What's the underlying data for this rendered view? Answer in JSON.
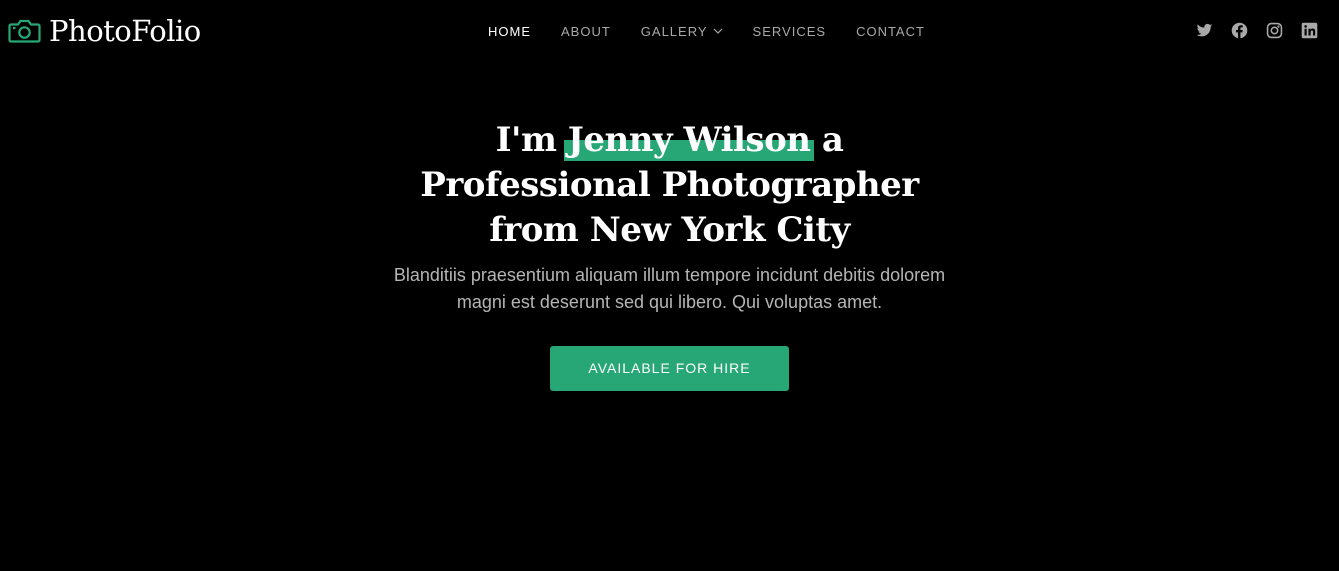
{
  "brand": {
    "name": "PhotoFolio",
    "icon": "camera-icon",
    "accent_color": "#27a776"
  },
  "nav": {
    "items": [
      {
        "label": "HOME",
        "active": true
      },
      {
        "label": "ABOUT",
        "active": false
      },
      {
        "label": "GALLERY",
        "active": false,
        "dropdown_icon": "chevron-down-icon"
      },
      {
        "label": "SERVICES",
        "active": false
      },
      {
        "label": "CONTACT",
        "active": false
      }
    ]
  },
  "social": {
    "icons": [
      "twitter-icon",
      "facebook-icon",
      "instagram-icon",
      "linkedin-icon"
    ],
    "icon_color": "#a9a9a9"
  },
  "hero": {
    "title_prefix": "I'm",
    "title_name": "Jenny Wilson",
    "title_suffix": "a",
    "title_line2": "Professional Photographer",
    "title_line3": "from New York City",
    "description": "Blanditiis praesentium aliquam illum tempore incidunt debitis dolorem magni est deserunt sed qui libero. Qui voluptas amet.",
    "cta_label": "AVAILABLE FOR HIRE"
  },
  "colors": {
    "background": "#000000",
    "text": "#ffffff",
    "muted_text": "#b5b5b5"
  }
}
